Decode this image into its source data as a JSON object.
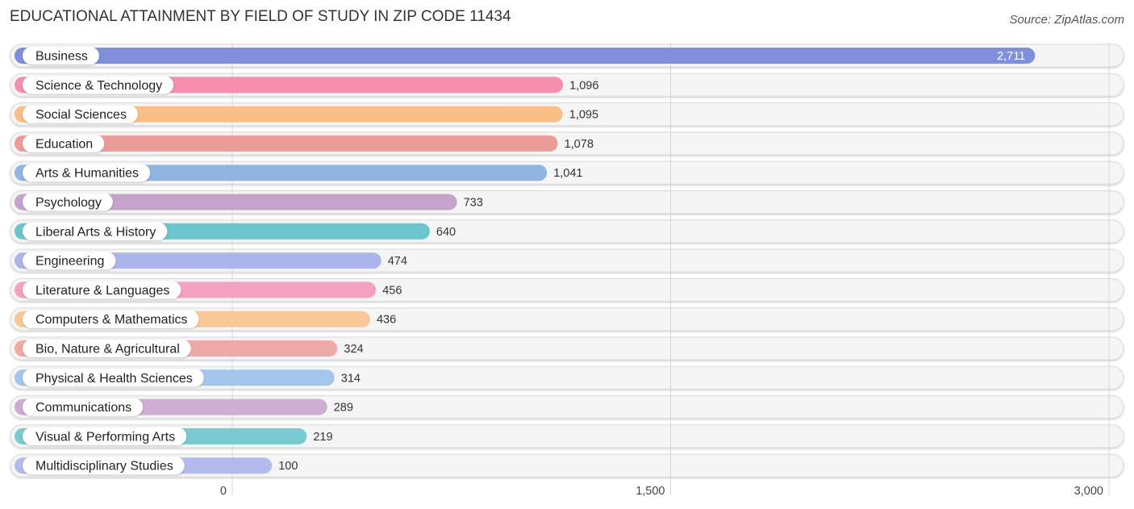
{
  "header": {
    "title": "EDUCATIONAL ATTAINMENT BY FIELD OF STUDY IN ZIP CODE 11434",
    "source": "Source: ZipAtlas.com"
  },
  "chart_data": {
    "type": "bar",
    "orientation": "horizontal",
    "title": "EDUCATIONAL ATTAINMENT BY FIELD OF STUDY IN ZIP CODE 11434",
    "xlabel": "",
    "ylabel": "",
    "xlim": [
      0,
      3000
    ],
    "x_ticks": [
      0,
      1500,
      3000
    ],
    "x_tick_labels": [
      "0",
      "1,500",
      "3,000"
    ],
    "grid": true,
    "categories": [
      "Business",
      "Science & Technology",
      "Social Sciences",
      "Education",
      "Arts & Humanities",
      "Psychology",
      "Liberal Arts & History",
      "Engineering",
      "Literature & Languages",
      "Computers & Mathematics",
      "Bio, Nature & Agricultural",
      "Physical & Health Sciences",
      "Communications",
      "Visual & Performing Arts",
      "Multidisciplinary Studies"
    ],
    "values": [
      2711,
      1096,
      1095,
      1078,
      1041,
      733,
      640,
      474,
      456,
      436,
      324,
      314,
      289,
      219,
      100
    ],
    "value_labels": [
      "2,711",
      "1,096",
      "1,095",
      "1,078",
      "1,041",
      "733",
      "640",
      "474",
      "456",
      "436",
      "324",
      "314",
      "289",
      "219",
      "100"
    ],
    "colors": [
      "#7f8fdc",
      "#f58fb0",
      "#f9bf86",
      "#ec9c98",
      "#8fb6e3",
      "#c5a4cb",
      "#6cc4cc",
      "#adb5e8",
      "#f5a0be",
      "#f9c898",
      "#efa9a6",
      "#a5c6ec",
      "#cdadd2",
      "#79cbd0",
      "#b3bbec"
    ]
  }
}
